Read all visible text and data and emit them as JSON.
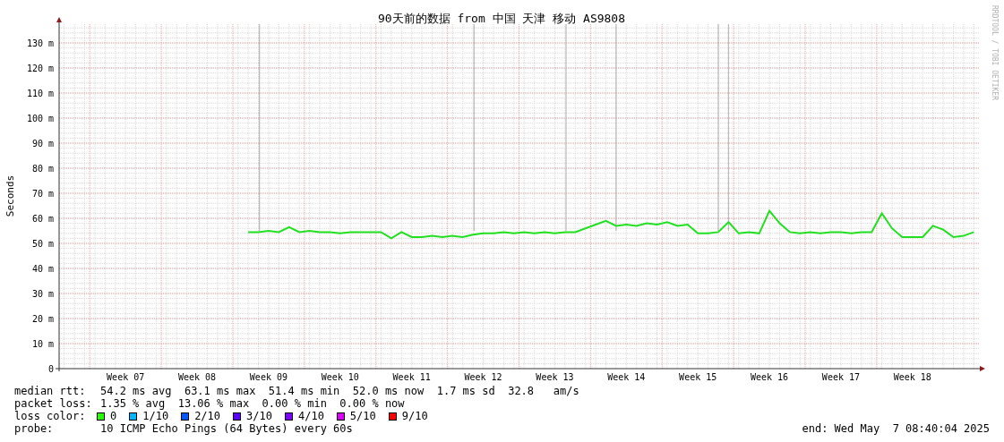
{
  "graph": {
    "title": "90天前的数据 from 中国 天津 移动 AS9808",
    "credit": "RRDTOOL / TOBI OETIKER",
    "chart_data": {
      "type": "line",
      "grid": true,
      "ylabel": "Seconds",
      "ylim": [
        0,
        137.5
      ],
      "categories": [
        null,
        null,
        null,
        null,
        null,
        null,
        "Week 07",
        null,
        null,
        null,
        null,
        null,
        null,
        "Week 08",
        null,
        null,
        null,
        null,
        null,
        null,
        "Week 09",
        null,
        null,
        null,
        null,
        null,
        null,
        "Week 10",
        null,
        null,
        null,
        null,
        null,
        null,
        "Week 11",
        null,
        null,
        null,
        null,
        null,
        null,
        "Week 12",
        null,
        null,
        null,
        null,
        null,
        null,
        "Week 13",
        null,
        null,
        null,
        null,
        null,
        null,
        "Week 14",
        null,
        null,
        null,
        null,
        null,
        null,
        "Week 15",
        null,
        null,
        null,
        null,
        null,
        null,
        "Week 16",
        null,
        null,
        null,
        null,
        null,
        null,
        "Week 17",
        null,
        null,
        null,
        null,
        null,
        null,
        "Week 18",
        null,
        null,
        null,
        null,
        null,
        null
      ],
      "yticks": [
        {
          "value": 0,
          "label": "0"
        },
        {
          "value": 10,
          "label": "10 m"
        },
        {
          "value": 20,
          "label": "20 m"
        },
        {
          "value": 30,
          "label": "30 m"
        },
        {
          "value": 40,
          "label": "40 m"
        },
        {
          "value": 50,
          "label": "50 m"
        },
        {
          "value": 60,
          "label": "60 m"
        },
        {
          "value": 70,
          "label": "70 m"
        },
        {
          "value": 80,
          "label": "80 m"
        },
        {
          "value": 90,
          "label": "90 m"
        },
        {
          "value": 100,
          "label": "100 m"
        },
        {
          "value": 110,
          "label": "110 m"
        },
        {
          "value": 120,
          "label": "120 m"
        },
        {
          "value": 130,
          "label": "130 m"
        }
      ],
      "series": [
        {
          "color": "#20e020",
          "values": [
            null,
            null,
            null,
            null,
            null,
            null,
            null,
            null,
            null,
            null,
            null,
            null,
            null,
            null,
            null,
            null,
            null,
            null,
            54.5,
            54.5,
            55,
            54.5,
            56.5,
            54.5,
            55,
            54.5,
            54.5,
            54,
            54.5,
            54.5,
            54.5,
            54.5,
            52,
            54.5,
            52.5,
            52.5,
            53,
            52.5,
            53,
            52.5,
            53.5,
            54,
            54,
            54.5,
            54,
            54.5,
            54,
            54.5,
            54,
            54.5,
            54.5,
            56,
            57.5,
            59,
            57,
            57.5,
            57,
            58,
            57.5,
            58.5,
            57,
            57.5,
            54,
            54,
            54.5,
            58.5,
            54,
            54.5,
            54,
            63,
            58,
            54.5,
            54,
            54.5,
            54,
            54.5,
            54.5,
            54,
            54.5,
            54.5,
            62,
            56,
            52.5,
            52.5,
            52.5,
            57,
            55.5,
            52.5,
            53,
            54.5
          ]
        }
      ]
    }
  },
  "legend": {
    "rows": [
      {
        "label": "median rtt:",
        "text": "54.2 ms avg  63.1 ms max  51.4 ms min  52.0 ms now  1.7 ms sd  32.8   am/s"
      },
      {
        "label": "packet loss:",
        "text": "1.35 % avg  13.06 % max  0.00 % min  0.00 % now"
      }
    ],
    "loss_color": {
      "label": "loss color:",
      "items": [
        {
          "label": "0",
          "color": "#26ff00"
        },
        {
          "label": "1/10",
          "color": "#00b8ff"
        },
        {
          "label": "2/10",
          "color": "#0059ff"
        },
        {
          "label": "3/10",
          "color": "#5e00ff"
        },
        {
          "label": "4/10",
          "color": "#7e00ff"
        },
        {
          "label": "5/10",
          "color": "#dd00ff"
        },
        {
          "label": "9/10",
          "color": "#ff0000"
        }
      ]
    },
    "probe": {
      "label": "probe:",
      "text": "10 ICMP Echo Pings (64 Bytes) every 60s"
    },
    "end": "end: Wed May  7 08:40:04 2025"
  }
}
